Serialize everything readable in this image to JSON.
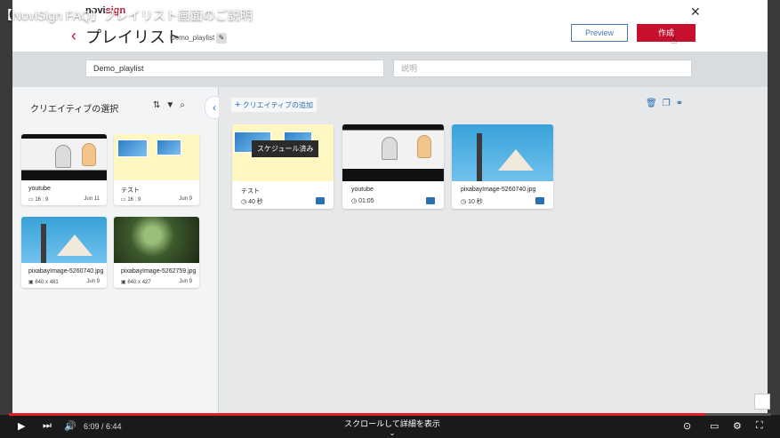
{
  "video": {
    "title": "【NoviSign FAQ】プレイリスト画面のご説明",
    "time": "6:09 / 6:44",
    "scroll_hint": "スクロールして詳細を表示",
    "progress_fraction": 0.914
  },
  "app": {
    "logo": {
      "prefix": "novi",
      "accent": "sign"
    },
    "page_title": "プレイリスト",
    "playlist_label": "Demo_playlist *",
    "buttons": {
      "preview": "Preview",
      "create": "作成"
    },
    "fields": {
      "name_value": "Demo_playlist",
      "description_placeholder": "説明"
    },
    "left": {
      "title": "クリエイティブの選択",
      "cards": [
        {
          "name": "youtube",
          "meta": "16 : 9",
          "date": "Jun 11",
          "type": "youtube"
        },
        {
          "name": "テスト",
          "meta": "16 : 9",
          "date": "Jun 9",
          "type": "test"
        },
        {
          "name": "pixabayImage-5260740.jpg",
          "meta": "640 x 481",
          "date": "Jun 9",
          "type": "church"
        },
        {
          "name": "pixabayImage-5262759.jpg",
          "meta": "640 x 427",
          "date": "Jun 9",
          "type": "butterfly"
        }
      ]
    },
    "right": {
      "add_label": "クリエイティブの追加",
      "schedule_tooltip": "スケジュール済み",
      "items": [
        {
          "name": "テスト",
          "duration": "40 秒",
          "type": "test"
        },
        {
          "name": "youtube",
          "duration": "01:05",
          "type": "youtube"
        },
        {
          "name": "pixabayImage-5260740.jpg",
          "duration": "10 秒",
          "type": "church"
        }
      ]
    }
  },
  "colors": {
    "accent": "#c8102e",
    "link": "#2a6fb0",
    "progress": "#e31b23"
  }
}
